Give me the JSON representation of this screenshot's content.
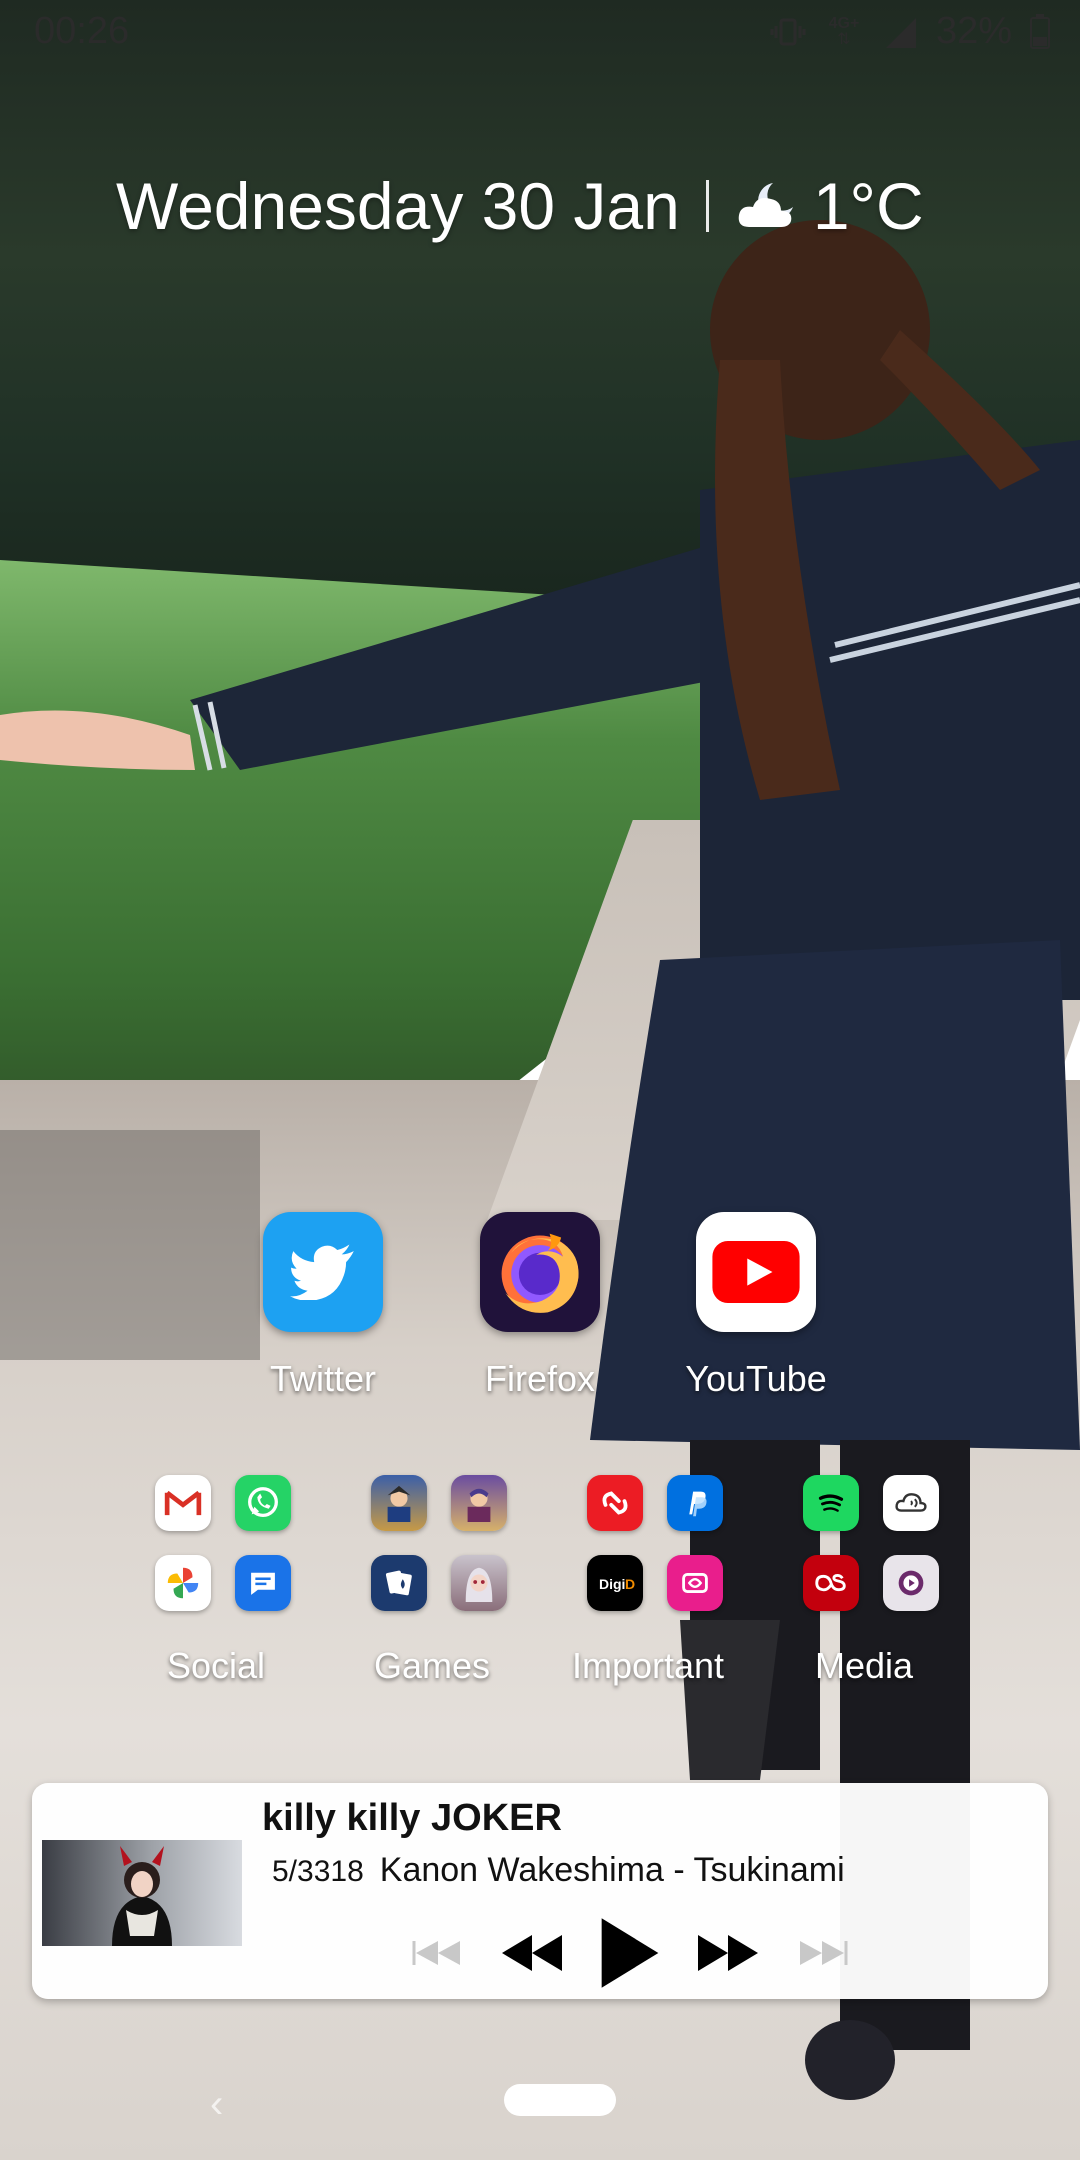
{
  "status_bar": {
    "time": "00:26",
    "network_label": "4G+",
    "battery": "32%",
    "icons": [
      "vibrate-icon",
      "network-icon",
      "signal-icon",
      "battery-icon"
    ]
  },
  "glance": {
    "date": "Wednesday 30 Jan",
    "temperature": "1°C",
    "weather_icon": "cloudy-night-icon"
  },
  "dock_apps": [
    {
      "label": "Twitter",
      "icon": "twitter-icon",
      "color": "#1da1f2"
    },
    {
      "label": "Firefox",
      "icon": "firefox-icon",
      "color": "#20123a"
    },
    {
      "label": "YouTube",
      "icon": "youtube-icon",
      "color": "#ff0000"
    }
  ],
  "folders": [
    {
      "label": "Social",
      "apps": [
        "gmail-icon",
        "whatsapp-icon",
        "google-photos-icon",
        "messages-icon"
      ]
    },
    {
      "label": "Games",
      "apps": [
        "ace-attorney-icon",
        "ace-attorney-2-icon",
        "solitaire-icon",
        "anime-game-icon"
      ]
    },
    {
      "label": "Important",
      "apps": [
        "authy-icon",
        "paypal-icon",
        "digid-icon",
        "wallet-icon"
      ]
    },
    {
      "label": "Media",
      "apps": [
        "spotify-icon",
        "cloud-audio-icon",
        "lastfm-icon",
        "podcast-icon"
      ]
    }
  ],
  "music_widget": {
    "title": "killy killy JOKER",
    "position": "5/3318",
    "artist_track": "Kanon Wakeshima - Tsukinami",
    "controls": [
      "skip-previous-icon",
      "rewind-icon",
      "play-icon",
      "fast-forward-icon",
      "skip-next-icon"
    ]
  },
  "nav": {
    "back": "‹"
  }
}
